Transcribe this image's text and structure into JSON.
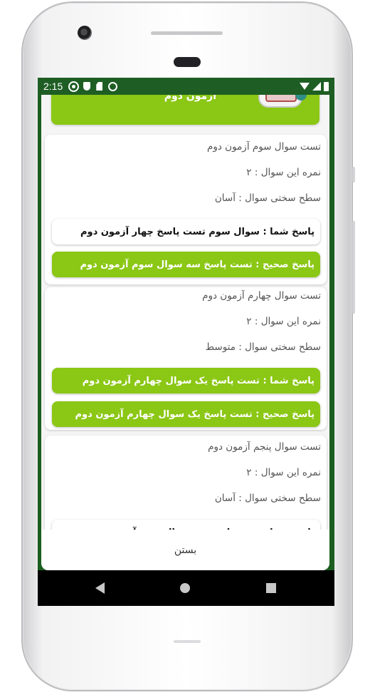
{
  "status_bar": {
    "time": "2:15",
    "icons": [
      "gear-icon",
      "shield-icon",
      "sd-card-icon",
      "sync-circle-icon",
      "wifi-icon",
      "signal-icon",
      "battery-icon"
    ]
  },
  "banner": {
    "title": "آزمون دوم",
    "color": "#8bc715"
  },
  "questions": [
    {
      "title": "تست سوال سوم آزمون دوم",
      "score": "نمره این سوال : ۲",
      "difficulty": "سطح سختی سوال : آسان",
      "your_answer": "پاسخ شما : سوال سوم تست پاسخ چهار آزمون دوم",
      "correct_answer": "پاسخ صحیح : تست پاسخ سه سوال سوم آزمون دوم"
    },
    {
      "title": "تست سوال چهارم آزمون دوم",
      "score": "نمره این سوال : ۲",
      "difficulty": "سطح سختی سوال : متوسط",
      "your_answer": "پاسخ شما : تست پاسخ یک سوال چهارم آزمون دوم",
      "correct_answer": "پاسخ صحیح : تست پاسخ یک سوال چهارم آزمون دوم"
    },
    {
      "title": "تست سوال پنجم آزمون دوم",
      "score": "نمره این سوال : ۲",
      "difficulty": "سطح سختی سوال : آسان",
      "your_answer": "پاسخ شما : تست پاسخ سه سوال پنجم آزمون دوم"
    }
  ],
  "dialog": {
    "close_label": "بستن"
  },
  "colors": {
    "accent_green": "#8bc715",
    "statusbar_green": "#1e5e24"
  }
}
